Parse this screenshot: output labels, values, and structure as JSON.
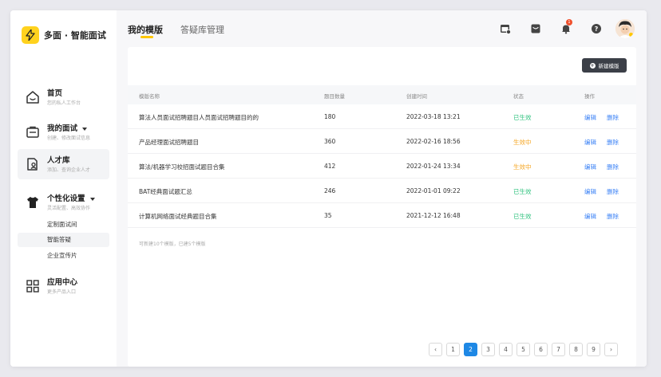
{
  "app": {
    "logo_text": "多面 · 智能面试"
  },
  "sidebar": {
    "items": [
      {
        "title": "首页",
        "subtitle": "您的私人工作台",
        "icon": "home-icon"
      },
      {
        "title": "我的面试",
        "subtitle": "创建、修改面试信息",
        "icon": "interview-icon"
      },
      {
        "title": "人才库",
        "subtitle": "添加、查询企业人才",
        "icon": "talent-icon"
      },
      {
        "title": "个性化设置",
        "subtitle": "灵活配置、高效协作",
        "icon": "shirt-icon"
      },
      {
        "title": "应用中心",
        "subtitle": "更多产品入口",
        "icon": "apps-icon"
      }
    ],
    "subitems": [
      "定制面试间",
      "智能答疑",
      "企业宣传片"
    ]
  },
  "header": {
    "tabs": [
      "我的模版",
      "答疑库管理"
    ],
    "notification_count": "1"
  },
  "toolbar": {
    "new_template_label": "新建模版"
  },
  "table": {
    "columns": [
      "模版名称",
      "题目数量",
      "创建时间",
      "状态",
      "操作"
    ],
    "rows": [
      {
        "name": "算法人员面试招聘题目人员面试招聘题目的的",
        "count": "180",
        "created": "2022-03-18 13:21",
        "status": "已生效",
        "edit": "编辑",
        "delete": "删除"
      },
      {
        "name": "产品经理面试招聘题目",
        "count": "360",
        "created": "2022-02-16 18:56",
        "status": "生效中",
        "edit": "编辑",
        "delete": "删除"
      },
      {
        "name": "算法/机器学习校招面试题目合集",
        "count": "412",
        "created": "2022-01-24 13:34",
        "status": "生效中",
        "edit": "编辑",
        "delete": "删除"
      },
      {
        "name": "BAT经典面试题汇总",
        "count": "246",
        "created": "2022-01-01 09:22",
        "status": "已生效",
        "edit": "编辑",
        "delete": "删除"
      },
      {
        "name": "计算机网络面试经典题目合集",
        "count": "35",
        "created": "2021-12-12 16:48",
        "status": "已生效",
        "edit": "编辑",
        "delete": "删除"
      }
    ],
    "footnote": "可新建10个模版，已建5个模版"
  },
  "pagination": {
    "prev": "‹",
    "next": "›",
    "pages": [
      "1",
      "2",
      "3",
      "4",
      "5",
      "6",
      "7",
      "8",
      "9"
    ],
    "current": "2"
  },
  "colors": {
    "accent": "#ffc700",
    "primary_blue": "#1e88e5",
    "status_active": "#2ec27e",
    "status_pending": "#f5a623",
    "link": "#3b82f6",
    "badge": "#f0502d"
  }
}
